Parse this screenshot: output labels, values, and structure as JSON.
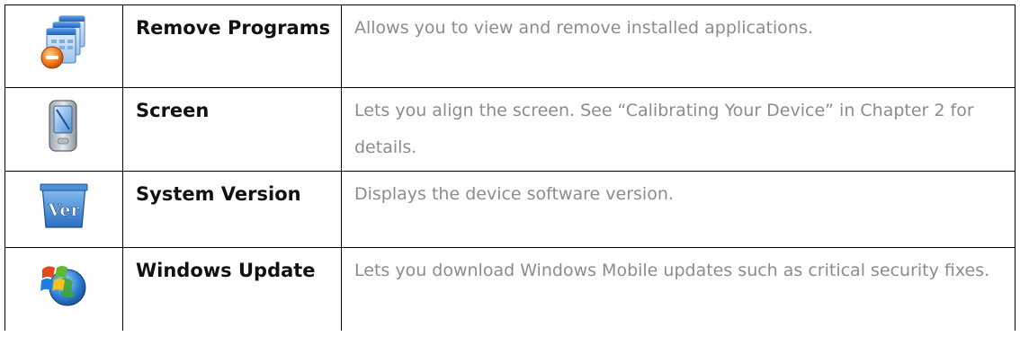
{
  "rows": [
    {
      "icon": "remove-programs-icon",
      "name": "Remove Programs",
      "description": "Allows you to view and remove installed applications."
    },
    {
      "icon": "screen-calibration-icon",
      "name": "Screen",
      "description": "Lets you align the screen. See “Calibrating Your Device” in Chapter 2 for details."
    },
    {
      "icon": "system-version-icon",
      "name": "System Version",
      "description": "Displays the device software version."
    },
    {
      "icon": "windows-update-icon",
      "name": "Windows Update",
      "description": "Lets you download Windows Mobile updates such as critical security fixes."
    }
  ]
}
